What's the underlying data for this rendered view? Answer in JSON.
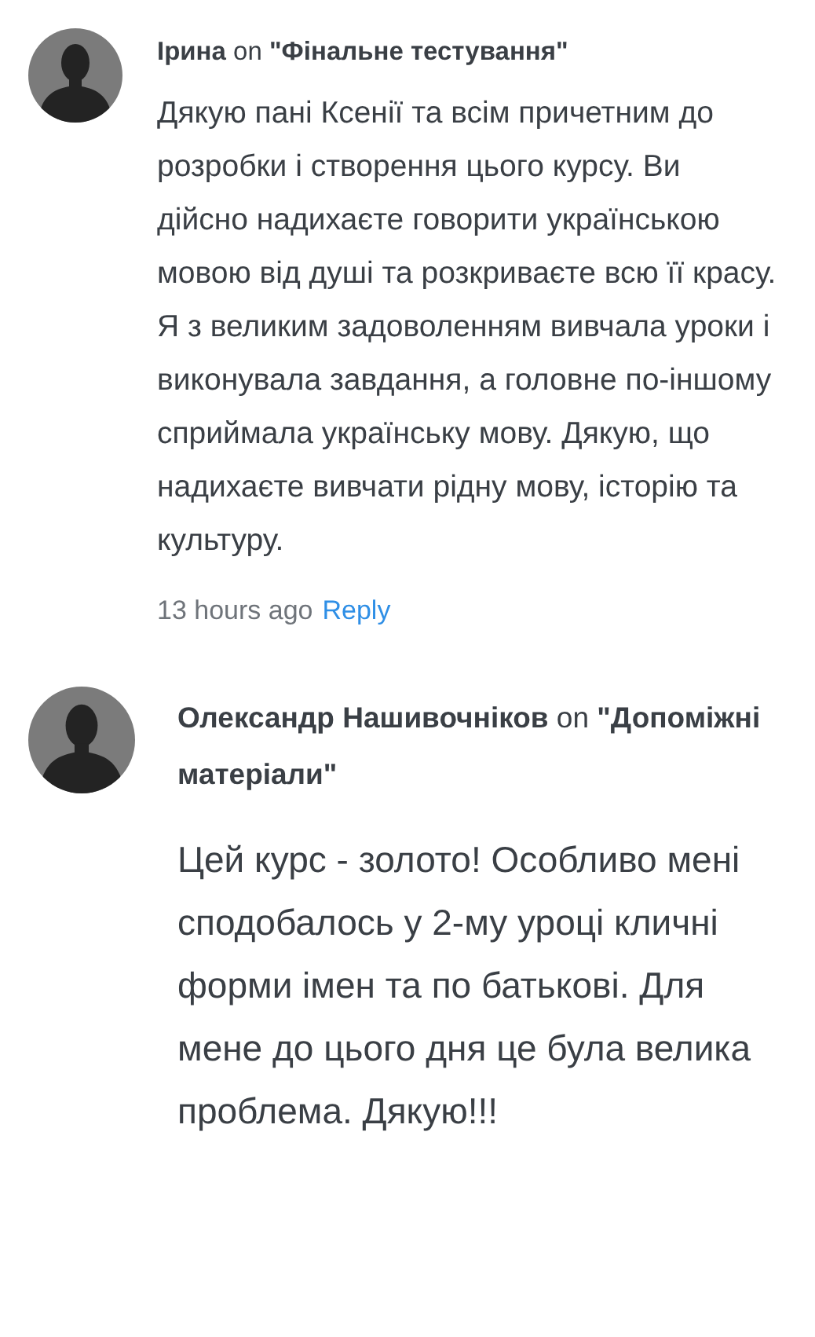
{
  "comments": [
    {
      "kind": "compact",
      "heading": "**Ірина** on **\"Фінальне тестування\"**",
      "body": "Дякую пані Ксенії та всім причетним до розробки і створення цього курсу. Ви дійсно надихаєте говорити українською мовою від душі та розкриваєте всю її красу. Я з великим задоволенням вивчала уроки і виконувала завдання, а головне по-іншому сприймала українську мову. Дякую, що надихаєте вивчати рідну мову, історію та культуру.",
      "time": "13 hours ago",
      "reply": "Reply"
    },
    {
      "kind": "large",
      "heading": "**Олександр Нашивочніков** on **\"Допоміжні матеріали\"**",
      "body": "Цей курс - золото! Особливо мені сподобалось у 2-му уроці кличні форми імен та по батькові. Для мене до цього дня це була велика проблема. Дякую!!!"
    }
  ]
}
